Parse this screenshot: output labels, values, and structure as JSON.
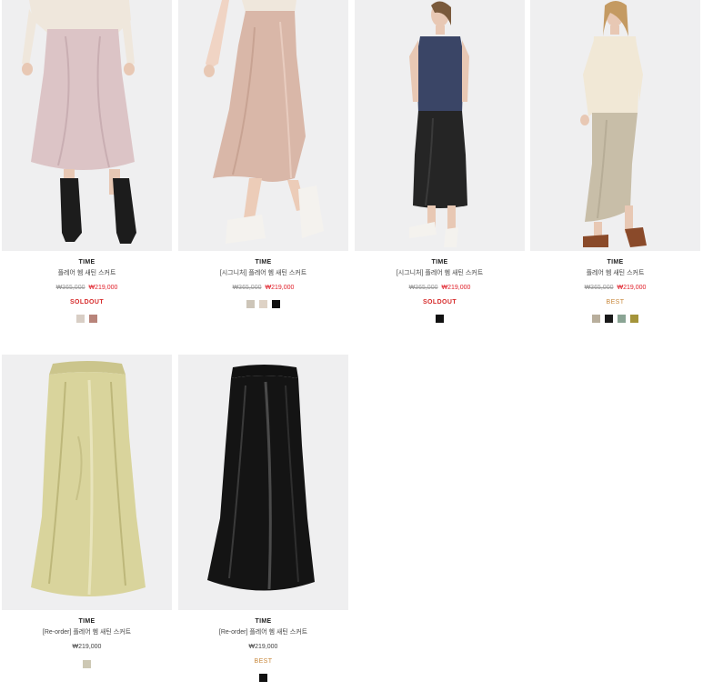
{
  "products": [
    {
      "brand": "TIME",
      "name": "플레어 헴 새틴 스커트",
      "original_price": "₩365,000",
      "price": "₩219,000",
      "badge": "SOLDOUT",
      "swatches": [
        "#d8cec5",
        "#b8847a"
      ]
    },
    {
      "brand": "TIME",
      "name": "[시그니처] 플레어 헴 새틴 스커트",
      "original_price": "₩365,000",
      "price": "₩219,000",
      "badge": "",
      "swatches": [
        "#cdc5b8",
        "#ded2c5",
        "#111111"
      ]
    },
    {
      "brand": "TIME",
      "name": "[시그니처] 플레어 헴 새틴 스커트",
      "original_price": "₩365,000",
      "price": "₩219,000",
      "badge": "SOLDOUT",
      "swatches": [
        "#111111"
      ]
    },
    {
      "brand": "TIME",
      "name": "플레어 헴 새틴 스커트",
      "original_price": "₩365,000",
      "price": "₩219,000",
      "badge": "BEST",
      "swatches": [
        "#b8ae9c",
        "#1a1a1a",
        "#8aa494",
        "#a4943a"
      ]
    },
    {
      "brand": "TIME",
      "name": "[Re-order] 플레어 헴 새틴 스커트",
      "original_price": "",
      "price": "₩219,000",
      "badge": "",
      "swatches": [
        "#cdc8b4"
      ]
    },
    {
      "brand": "TIME",
      "name": "[Re-order] 플레어 헴 새틴 스커트",
      "original_price": "",
      "price": "₩219,000",
      "badge": "BEST",
      "swatches": [
        "#111111"
      ]
    }
  ]
}
